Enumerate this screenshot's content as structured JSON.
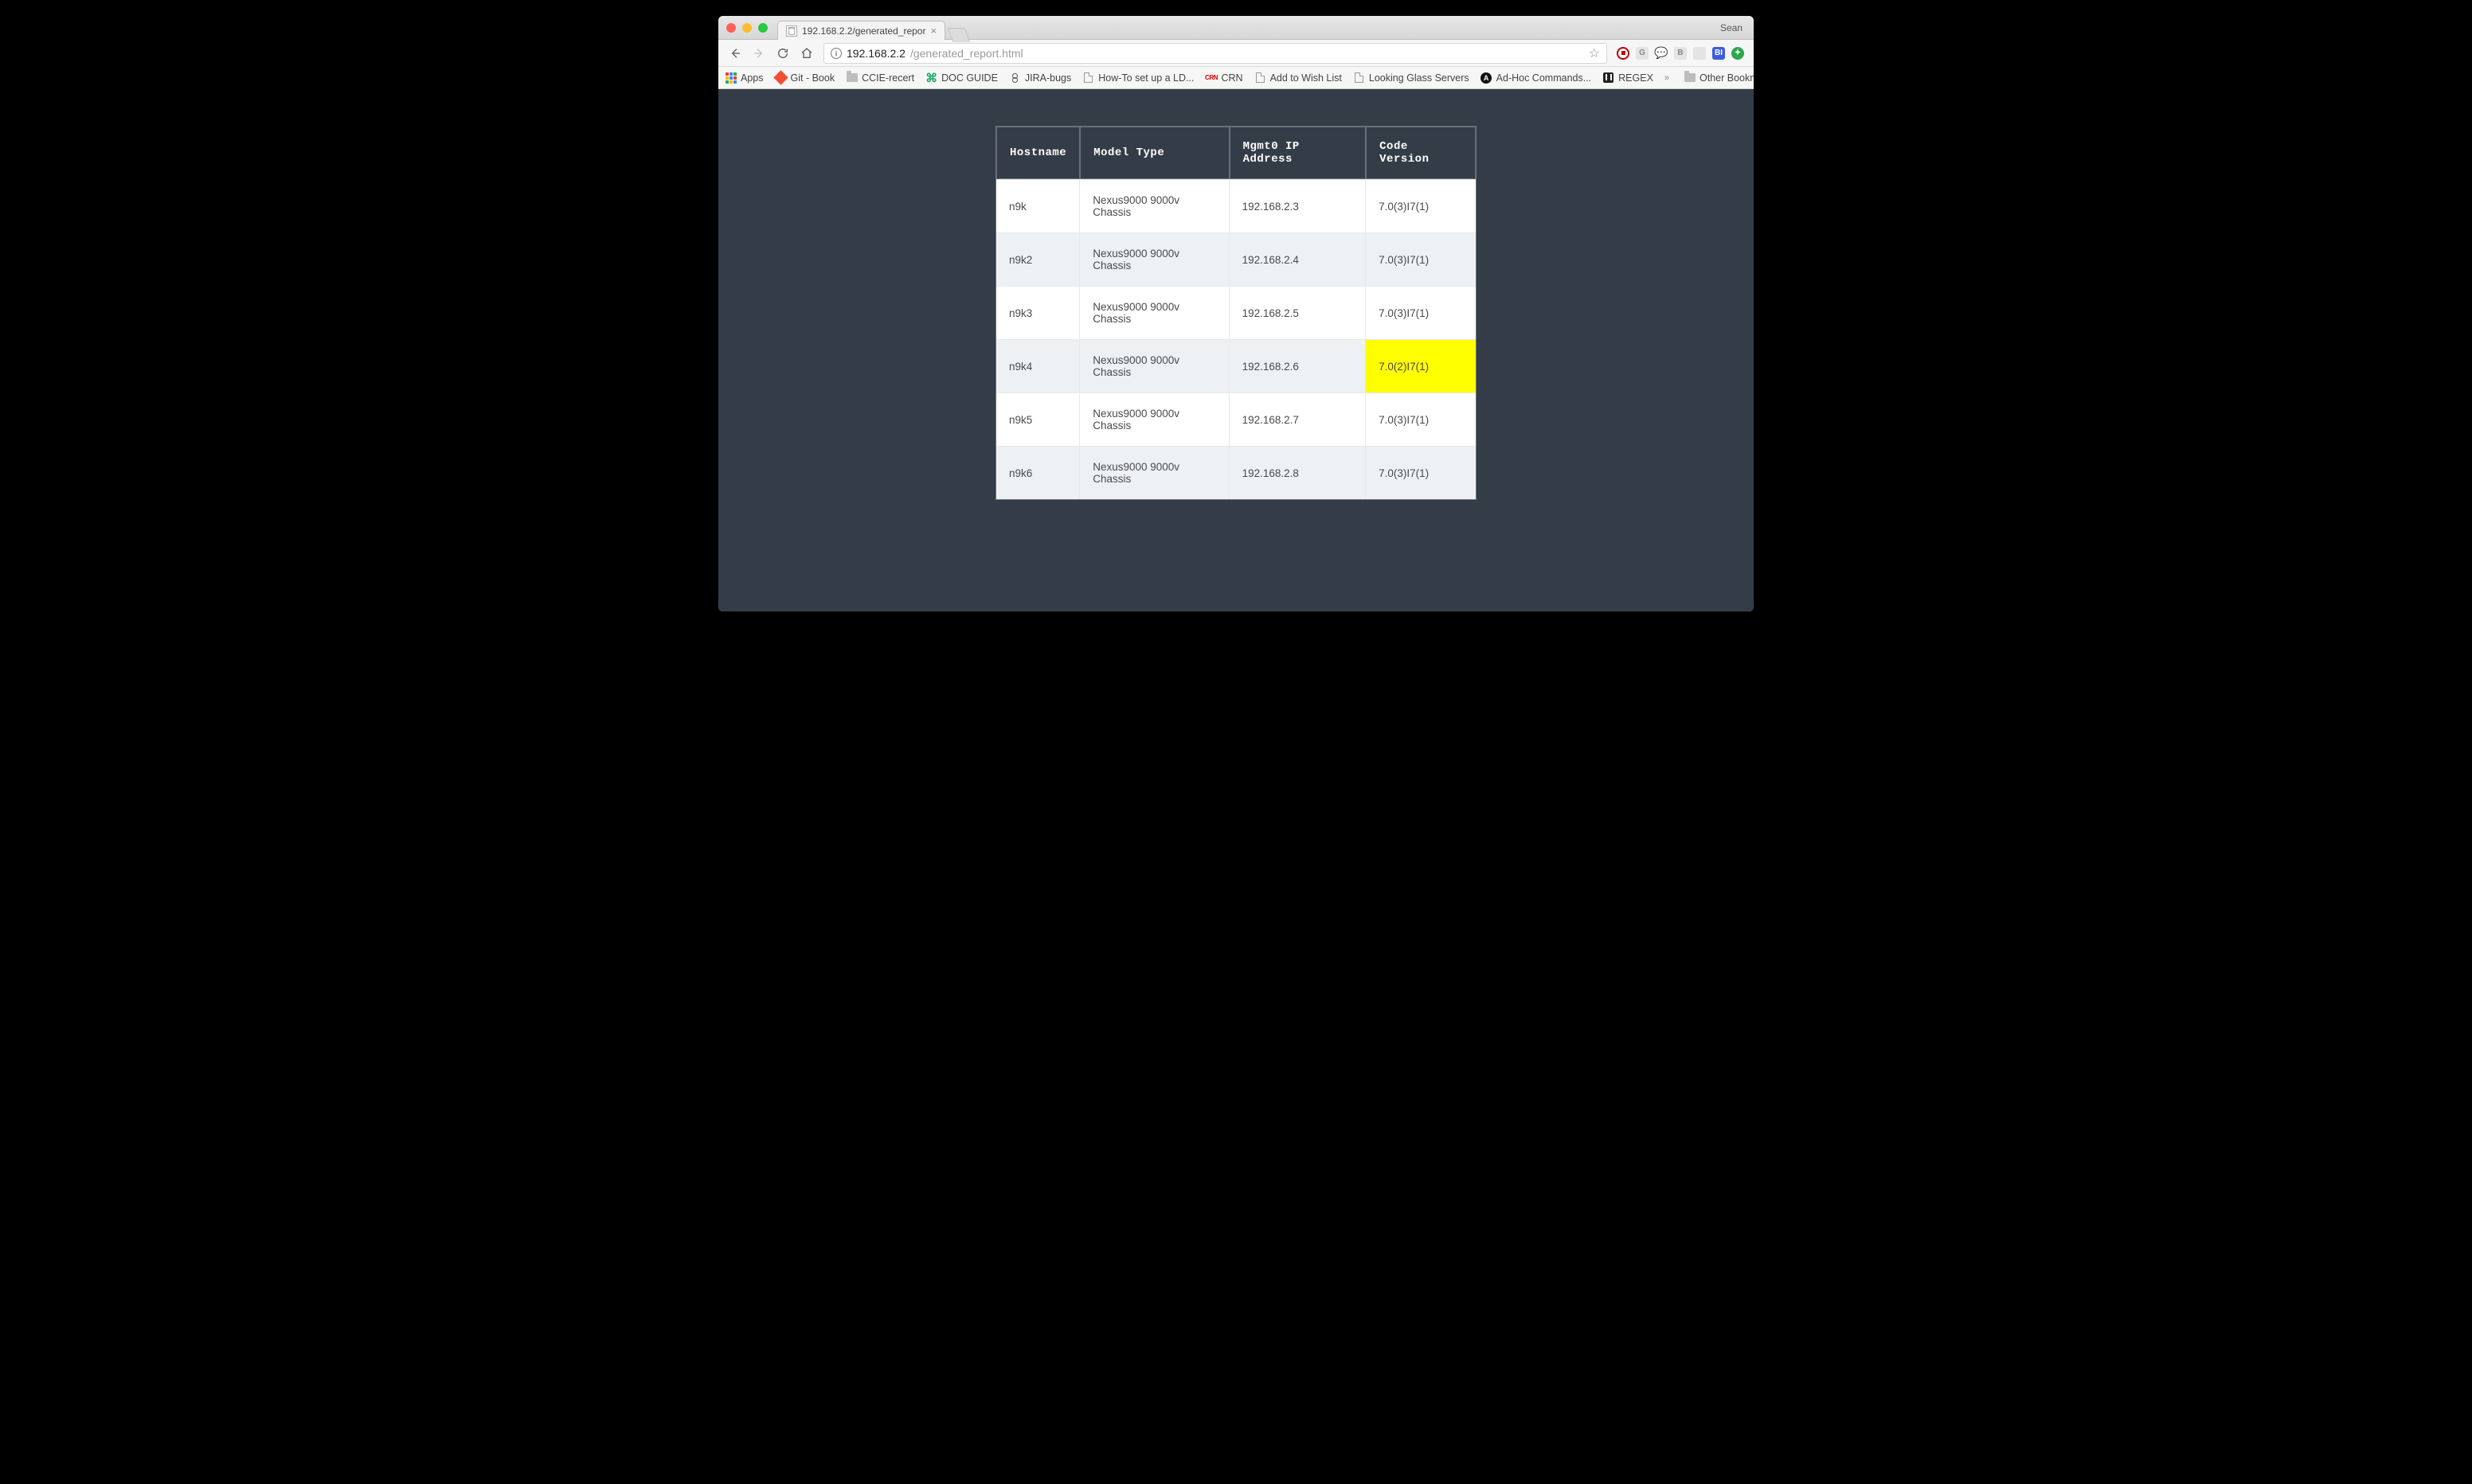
{
  "window": {
    "user_label": "Sean",
    "tab_title": "192.168.2.2/generated_repor"
  },
  "omnibox": {
    "host": "192.168.2.2",
    "path": "/generated_report.html"
  },
  "bookmarks": {
    "apps": "Apps",
    "git": "Git - Book",
    "ccie": "CCIE-recert",
    "docguide": "DOC GUIDE",
    "jira": "JIRA-bugs",
    "howto": "How-To set up a LD...",
    "crn": "CRN",
    "wishlist": "Add to Wish List",
    "glass": "Looking Glass Servers",
    "adhoc": "Ad-Hoc Commands...",
    "regex": "REGEX",
    "other": "Other Bookmarks"
  },
  "table": {
    "headers": {
      "hostname": "Hostname",
      "model": "Model Type",
      "mgmt": "Mgmt0 IP Address",
      "version": "Code Version"
    },
    "rows": [
      {
        "hostname": "n9k",
        "model": "Nexus9000 9000v Chassis",
        "mgmt": "192.168.2.3",
        "version": "7.0(3)I7(1)",
        "highlight_version": false
      },
      {
        "hostname": "n9k2",
        "model": "Nexus9000 9000v Chassis",
        "mgmt": "192.168.2.4",
        "version": "7.0(3)I7(1)",
        "highlight_version": false
      },
      {
        "hostname": "n9k3",
        "model": "Nexus9000 9000v Chassis",
        "mgmt": "192.168.2.5",
        "version": "7.0(3)I7(1)",
        "highlight_version": false
      },
      {
        "hostname": "n9k4",
        "model": "Nexus9000 9000v Chassis",
        "mgmt": "192.168.2.6",
        "version": "7.0(2)I7(1)",
        "highlight_version": true
      },
      {
        "hostname": "n9k5",
        "model": "Nexus9000 9000v Chassis",
        "mgmt": "192.168.2.7",
        "version": "7.0(3)I7(1)",
        "highlight_version": false
      },
      {
        "hostname": "n9k6",
        "model": "Nexus9000 9000v Chassis",
        "mgmt": "192.168.2.8",
        "version": "7.0(3)I7(1)",
        "highlight_version": false
      }
    ]
  }
}
